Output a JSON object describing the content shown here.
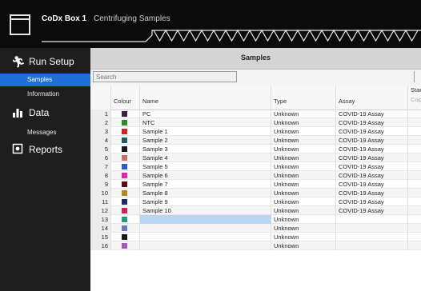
{
  "device": {
    "name": "CoDx Box 1",
    "status": "Centrifuging Samples"
  },
  "nav": [
    {
      "label": "Run Setup",
      "icon": "run-icon"
    },
    {
      "label": "Samples",
      "active": true
    },
    {
      "label": "Information"
    },
    {
      "label": "Data",
      "icon": "bar-chart-icon"
    },
    {
      "label": "Messages"
    },
    {
      "label": "Reports",
      "icon": "report-icon"
    }
  ],
  "section_title": "Samples",
  "search": {
    "placeholder": "Search"
  },
  "columns": {
    "colour": "Colour",
    "name": "Name",
    "type": "Type",
    "assay": "Assay",
    "standard": "Stand",
    "standard_sub": "Copi"
  },
  "rows": [
    {
      "num": "1",
      "color": "#3b1f3f",
      "name": "PC",
      "type": "Unknown",
      "assay": "COVID-19 Assay"
    },
    {
      "num": "2",
      "color": "#2e8b2e",
      "name": "NTC",
      "type": "Unknown",
      "assay": "COVID-19 Assay"
    },
    {
      "num": "3",
      "color": "#d61f1f",
      "name": "Sample 1",
      "type": "Unknown",
      "assay": "COVID-19 Assay"
    },
    {
      "num": "4",
      "color": "#1f5f5a",
      "name": "Sample 2",
      "type": "Unknown",
      "assay": "COVID-19 Assay"
    },
    {
      "num": "5",
      "color": "#1a1a1a",
      "name": "Sample 3",
      "type": "Unknown",
      "assay": "COVID-19 Assay"
    },
    {
      "num": "6",
      "color": "#c86b6b",
      "name": "Sample 4",
      "type": "Unknown",
      "assay": "COVID-19 Assay"
    },
    {
      "num": "7",
      "color": "#2a5bd6",
      "name": "Sample 5",
      "type": "Unknown",
      "assay": "COVID-19 Assay"
    },
    {
      "num": "8",
      "color": "#d62aa8",
      "name": "Sample 6",
      "type": "Unknown",
      "assay": "COVID-19 Assay"
    },
    {
      "num": "9",
      "color": "#5a1010",
      "name": "Sample 7",
      "type": "Unknown",
      "assay": "COVID-19 Assay"
    },
    {
      "num": "10",
      "color": "#b08a1a",
      "name": "Sample 8",
      "type": "Unknown",
      "assay": "COVID-19 Assay"
    },
    {
      "num": "11",
      "color": "#1a2a6b",
      "name": "Sample 9",
      "type": "Unknown",
      "assay": "COVID-19 Assay"
    },
    {
      "num": "12",
      "color": "#d61f5a",
      "name": "Sample 10",
      "type": "Unknown",
      "assay": "COVID-19 Assay"
    },
    {
      "num": "13",
      "color": "#1f9a78",
      "name": "",
      "type": "Unknown",
      "assay": "",
      "editing": true
    },
    {
      "num": "14",
      "color": "#6a7ab8",
      "name": "",
      "type": "Unknown",
      "assay": ""
    },
    {
      "num": "15",
      "color": "#1a1a1a",
      "name": "",
      "type": "Unknown",
      "assay": ""
    },
    {
      "num": "16",
      "color": "#a05ab8",
      "name": "",
      "type": "Unknown",
      "assay": ""
    }
  ]
}
